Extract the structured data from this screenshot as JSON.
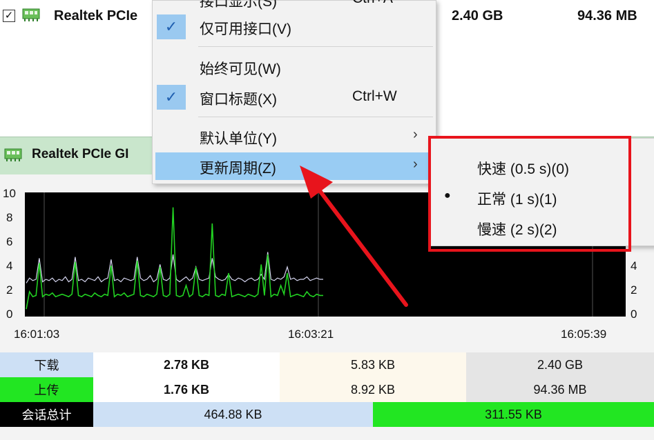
{
  "top_row": {
    "checkbox_mark": "✓",
    "adapter_name": "Realtek PCIe",
    "download_total": "2.40 GB",
    "upload_total": "94.36 MB"
  },
  "second_section": {
    "adapter_name": "Realtek PCIe GI"
  },
  "chart_data": {
    "type": "line",
    "yticks_left": [
      "10",
      "8",
      "6",
      "4",
      "2",
      "0"
    ],
    "yticks_right": [
      "4",
      "2",
      "0"
    ],
    "x_tick_labels": [
      "16:01:03",
      "16:03:21",
      "16:05:39"
    ],
    "ylim": [
      0,
      10
    ],
    "series": [
      {
        "color": "#d6d6f0",
        "values": [
          2.7,
          3.1,
          2.9,
          3.0,
          4.7,
          2.8,
          3.0,
          2.9,
          3.1,
          2.8,
          3.0,
          2.9,
          3.2,
          2.8,
          3.0,
          4.8,
          2.9,
          3.0,
          2.8,
          3.1,
          3.0,
          2.9,
          3.2,
          2.8,
          3.0,
          3.1,
          4.6,
          2.9,
          3.0,
          2.8,
          3.1,
          3.0,
          2.9,
          3.0,
          4.8,
          3.1,
          2.9,
          3.0,
          3.3,
          2.8,
          3.0,
          4.2,
          3.0,
          2.9,
          3.1,
          5.0,
          3.0,
          2.8,
          3.0,
          3.2,
          2.9,
          3.1,
          4.0,
          3.0,
          2.9,
          3.0,
          3.1,
          4.7,
          3.2,
          3.0,
          2.9,
          3.0,
          3.4,
          3.0,
          2.9,
          3.1,
          3.0,
          2.8,
          3.0,
          3.1,
          2.9,
          3.0,
          3.4,
          3.0,
          5.2,
          3.0,
          2.9,
          3.1,
          3.0,
          3.2,
          4.0,
          3.0,
          3.1,
          2.9,
          3.0,
          3.0,
          3.2,
          2.9,
          3.0,
          3.1,
          3.0,
          3.0
        ]
      },
      {
        "color": "#22d322",
        "values": [
          0.6,
          2.0,
          1.6,
          1.7,
          4.3,
          1.6,
          1.8,
          1.7,
          1.9,
          1.6,
          1.7,
          1.8,
          1.7,
          1.6,
          1.8,
          4.4,
          1.7,
          1.6,
          1.8,
          1.7,
          1.6,
          1.9,
          1.7,
          1.6,
          1.8,
          1.7,
          4.1,
          1.6,
          1.8,
          1.7,
          1.9,
          1.6,
          1.7,
          1.8,
          4.5,
          1.7,
          1.6,
          1.8,
          1.7,
          1.6,
          1.8,
          4.0,
          1.7,
          1.6,
          1.8,
          8.8,
          1.7,
          1.6,
          1.7,
          2.5,
          1.6,
          1.8,
          4.0,
          1.7,
          1.6,
          1.8,
          1.7,
          7.5,
          1.7,
          1.6,
          1.8,
          1.7,
          3.5,
          1.6,
          1.7,
          1.8,
          1.7,
          1.6,
          1.8,
          1.7,
          1.6,
          1.8,
          4.2,
          1.7,
          5.0,
          1.6,
          1.8,
          1.7,
          2.5,
          1.8,
          3.5,
          1.6,
          1.7,
          1.8,
          1.7,
          1.6,
          2.0,
          1.7,
          1.6,
          1.8,
          1.7,
          1.7
        ]
      }
    ]
  },
  "stats": {
    "download_label": "下载",
    "upload_label": "上传",
    "session_label": "会话总计",
    "download_current": "2.78 KB",
    "download_peak": "5.83 KB",
    "download_total": "2.40 GB",
    "upload_current": "1.76 KB",
    "upload_peak": "8.92 KB",
    "upload_total": "94.36 MB",
    "session_download": "464.88 KB",
    "session_upload": "311.55 KB"
  },
  "context_menu": {
    "partial_item_label": "接口显示(S)",
    "partial_item_shortcut": "Ctrl+A",
    "items": [
      {
        "label": "仅可用接口(V)",
        "shortcut": "",
        "checked": "✓"
      },
      {
        "label": "始终可见(W)",
        "shortcut": "",
        "checked": ""
      },
      {
        "label": "窗口标题(X)",
        "shortcut": "Ctrl+W",
        "checked": "✓"
      },
      {
        "label": "默认单位(Y)",
        "arrow": "›"
      },
      {
        "label": "更新周期(Z)",
        "arrow": "›"
      }
    ]
  },
  "submenu": {
    "items": [
      {
        "label": "快速 (0.5 s)(0)"
      },
      {
        "label": "正常 (1 s)(1)",
        "bullet": "●"
      },
      {
        "label": "慢速 (2 s)(2)"
      }
    ]
  },
  "colors": {
    "download": "#cde0f5",
    "upload": "#22e622",
    "session": "#000000",
    "highlight": "#9ac9f0",
    "annotation_red": "#e8141c"
  }
}
